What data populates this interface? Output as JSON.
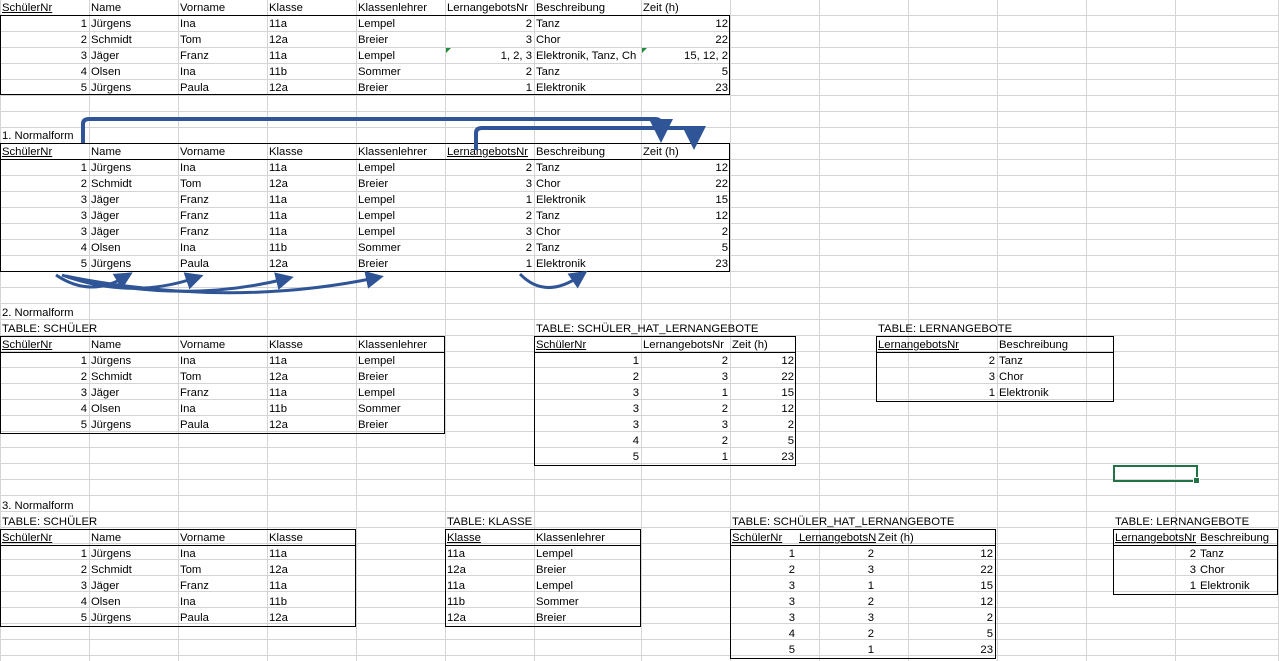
{
  "original": {
    "headers": [
      "SchülerNr",
      "Name",
      "Vorname",
      "Klasse",
      "Klassenlehrer",
      "LernangebotsNr",
      "Beschreibung",
      "Zeit (h)"
    ],
    "rows": [
      [
        "1",
        "Jürgens",
        "Ina",
        "11a",
        "Lempel",
        "2",
        "Tanz",
        "12"
      ],
      [
        "2",
        "Schmidt",
        "Tom",
        "12a",
        "Breier",
        "3",
        "Chor",
        "22"
      ],
      [
        "3",
        "Jäger",
        "Franz",
        "11a",
        "Lempel",
        "1, 2, 3",
        "Elektronik, Tanz, Ch",
        "15, 12, 2"
      ],
      [
        "4",
        "Olsen",
        "Ina",
        "11b",
        "Sommer",
        "2",
        "Tanz",
        "5"
      ],
      [
        "5",
        "Jürgens",
        "Paula",
        "12a",
        "Breier",
        "1",
        "Elektronik",
        "23"
      ]
    ]
  },
  "nf1": {
    "title": "1. Normalform",
    "headers": [
      "SchülerNr",
      "Name",
      "Vorname",
      "Klasse",
      "Klassenlehrer",
      "LernangebotsNr",
      "Beschreibung",
      "Zeit (h)"
    ],
    "rows": [
      [
        "1",
        "Jürgens",
        "Ina",
        "11a",
        "Lempel",
        "2",
        "Tanz",
        "12"
      ],
      [
        "2",
        "Schmidt",
        "Tom",
        "12a",
        "Breier",
        "3",
        "Chor",
        "22"
      ],
      [
        "3",
        "Jäger",
        "Franz",
        "11a",
        "Lempel",
        "1",
        "Elektronik",
        "15"
      ],
      [
        "3",
        "Jäger",
        "Franz",
        "11a",
        "Lempel",
        "2",
        "Tanz",
        "12"
      ],
      [
        "3",
        "Jäger",
        "Franz",
        "11a",
        "Lempel",
        "3",
        "Chor",
        "2"
      ],
      [
        "4",
        "Olsen",
        "Ina",
        "11b",
        "Sommer",
        "2",
        "Tanz",
        "5"
      ],
      [
        "5",
        "Jürgens",
        "Paula",
        "12a",
        "Breier",
        "1",
        "Elektronik",
        "23"
      ]
    ]
  },
  "nf2": {
    "title": "2. Normalform",
    "schueler": {
      "caption": "TABLE: SCHÜLER",
      "headers": [
        "SchülerNr",
        "Name",
        "Vorname",
        "Klasse",
        "Klassenlehrer"
      ],
      "rows": [
        [
          "1",
          "Jürgens",
          "Ina",
          "11a",
          "Lempel"
        ],
        [
          "2",
          "Schmidt",
          "Tom",
          "12a",
          "Breier"
        ],
        [
          "3",
          "Jäger",
          "Franz",
          "11a",
          "Lempel"
        ],
        [
          "4",
          "Olsen",
          "Ina",
          "11b",
          "Sommer"
        ],
        [
          "5",
          "Jürgens",
          "Paula",
          "12a",
          "Breier"
        ]
      ]
    },
    "hat": {
      "caption": "TABLE: SCHÜLER_HAT_LERNANGEBOTE",
      "headers": [
        "SchülerNr",
        "LernangebotsNr",
        "Zeit (h)"
      ],
      "rows": [
        [
          "1",
          "2",
          "12"
        ],
        [
          "2",
          "3",
          "22"
        ],
        [
          "3",
          "1",
          "15"
        ],
        [
          "3",
          "2",
          "12"
        ],
        [
          "3",
          "3",
          "2"
        ],
        [
          "4",
          "2",
          "5"
        ],
        [
          "5",
          "1",
          "23"
        ]
      ]
    },
    "lern": {
      "caption": "TABLE: LERNANGEBOTE",
      "headers": [
        "LernangebotsNr",
        "Beschreibung"
      ],
      "rows": [
        [
          "2",
          "Tanz"
        ],
        [
          "3",
          "Chor"
        ],
        [
          "1",
          "Elektronik"
        ]
      ]
    }
  },
  "nf3": {
    "title": "3. Normalform",
    "schueler": {
      "caption": "TABLE: SCHÜLER",
      "headers": [
        "SchülerNr",
        "Name",
        "Vorname",
        "Klasse"
      ],
      "rows": [
        [
          "1",
          "Jürgens",
          "Ina",
          "11a"
        ],
        [
          "2",
          "Schmidt",
          "Tom",
          "12a"
        ],
        [
          "3",
          "Jäger",
          "Franz",
          "11a"
        ],
        [
          "4",
          "Olsen",
          "Ina",
          "11b"
        ],
        [
          "5",
          "Jürgens",
          "Paula",
          "12a"
        ]
      ]
    },
    "klasse": {
      "caption": "TABLE: KLASSE",
      "headers": [
        "Klasse",
        "Klassenlehrer"
      ],
      "rows": [
        [
          "11a",
          "Lempel"
        ],
        [
          "12a",
          "Breier"
        ],
        [
          "11a",
          "Lempel"
        ],
        [
          "11b",
          "Sommer"
        ],
        [
          "12a",
          "Breier"
        ]
      ]
    },
    "hat": {
      "caption": "TABLE: SCHÜLER_HAT_LERNANGEBOTE",
      "headers": [
        "SchülerNr",
        "LernangebotsNr",
        "Zeit (h)"
      ],
      "rows": [
        [
          "1",
          "2",
          "12"
        ],
        [
          "2",
          "3",
          "22"
        ],
        [
          "3",
          "1",
          "15"
        ],
        [
          "3",
          "2",
          "12"
        ],
        [
          "3",
          "3",
          "2"
        ],
        [
          "4",
          "2",
          "5"
        ],
        [
          "5",
          "1",
          "23"
        ]
      ]
    },
    "lern": {
      "caption": "TABLE: LERNANGEBOTE",
      "headers": [
        "LernangebotsNr",
        "Beschreibung"
      ],
      "rows": [
        [
          "2",
          "Tanz"
        ],
        [
          "3",
          "Chor"
        ],
        [
          "1",
          "Elektronik"
        ]
      ]
    }
  },
  "colors": {
    "gridline": "#d4d4d4",
    "arrow": "#2f5597",
    "selection": "#217346",
    "comment_marker": "#1e8c3a"
  }
}
